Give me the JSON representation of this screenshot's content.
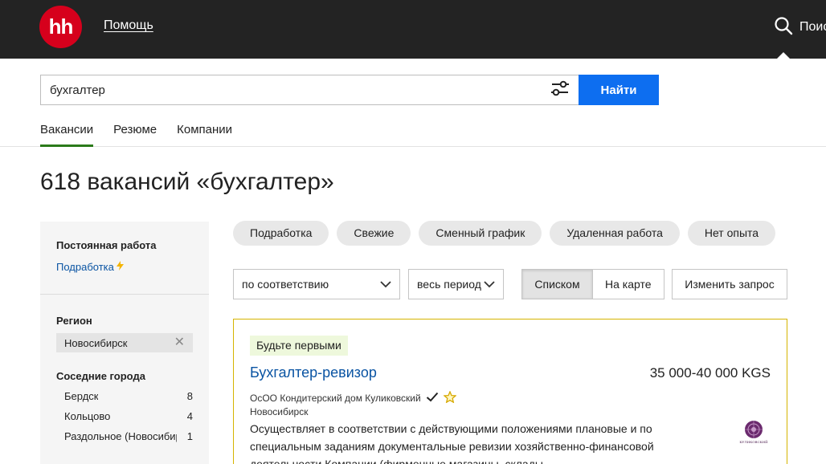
{
  "header": {
    "logo": "hh",
    "help_label": "Помощь",
    "search_label": "Поиск"
  },
  "search": {
    "query": "бухгалтер",
    "find_label": "Найти"
  },
  "tabs": [
    {
      "label": "Вакансии",
      "active": true
    },
    {
      "label": "Резюме",
      "active": false
    },
    {
      "label": "Компании",
      "active": false
    }
  ],
  "page_title": "618 вакансий «бухгалтер»",
  "sidebar": {
    "employment_heading": "Постоянная работа",
    "side_job_link": "Подработка",
    "region_heading": "Регион",
    "region_value": "Новосибирск",
    "nearby_heading": "Соседние города",
    "nearby_cities": [
      {
        "name": "Бердск",
        "count": "8"
      },
      {
        "name": "Кольцово",
        "count": "4"
      },
      {
        "name": "Раздольное (Новосибирск)",
        "count": "1"
      }
    ]
  },
  "quick_filters": [
    "Подработка",
    "Свежие",
    "Сменный график",
    "Удаленная работа",
    "Нет опыта"
  ],
  "controls": {
    "sort_value": "по соответствию",
    "period_value": "весь период",
    "view_list": "Списком",
    "view_map": "На карте",
    "edit_query": "Изменить запрос"
  },
  "vacancy": {
    "badge": "Будьте первыми",
    "title": "Бухгалтер-ревизор",
    "salary": "35 000-40 000 KGS",
    "company": "ОсОО Кондитерский дом Куликовский",
    "city": "Новосибирск",
    "description": "Осуществляет в соответствии с действующими положениями плановые и по специальным заданиям документальные ревизии хозяйственно-финансовой деятельности Компании (фирменные магазины, склады",
    "logo_text": "КУЛИКОВСКИЙ"
  },
  "colors": {
    "header_bg": "#232323",
    "brand_red": "#d6001c",
    "primary_blue": "#0d6ef0",
    "link_blue": "#0a54a3",
    "active_tab": "#2b7a1a",
    "card_border": "#d6b400"
  }
}
